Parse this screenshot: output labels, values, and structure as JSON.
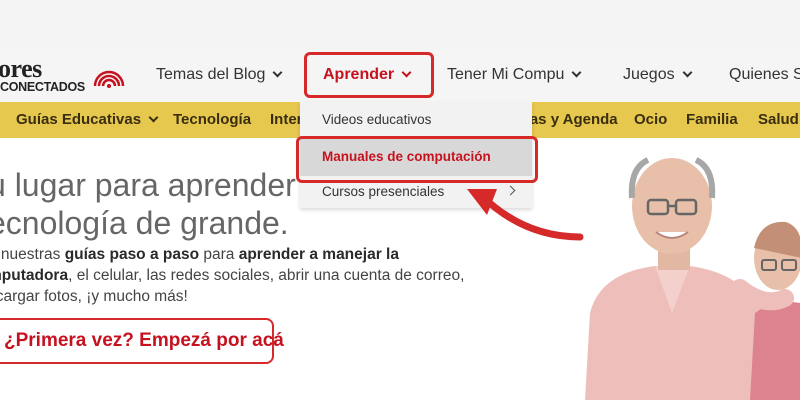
{
  "logo": {
    "top_text": "ores",
    "bottom_text": "CONECTADOS"
  },
  "nav": {
    "items": [
      {
        "label": "Temas del Blog"
      },
      {
        "label": "Aprender"
      },
      {
        "label": "Tener Mi Compu"
      },
      {
        "label": "Juegos"
      },
      {
        "label": "Quienes S"
      }
    ],
    "active_index": 1
  },
  "categories": {
    "items": [
      {
        "label": "Guías Educativas"
      },
      {
        "label": "Tecnología"
      },
      {
        "label": "Intern"
      },
      {
        "label": "ras y Agenda"
      },
      {
        "label": "Ocio"
      },
      {
        "label": "Familia"
      },
      {
        "label": "Salud"
      }
    ]
  },
  "dropdown": {
    "items": [
      {
        "label": "Videos educativos"
      },
      {
        "label": "Manuales de computación"
      },
      {
        "label": "Cursos presenciales"
      }
    ],
    "active_index": 1
  },
  "hero": {
    "title_line1": "u lugar para aprender",
    "title_line2": "ecnología de grande.",
    "body_p1": "á nuestras ",
    "body_b1": "guías paso a paso",
    "body_p2": " para ",
    "body_b2": "aprender a manejar la",
    "body_b3": "mputadora",
    "body_p3": ", el celular, las redes sociales, abrir una cuenta de correo,",
    "body_p4": "scargar fotos, ¡y mucho más!",
    "cta_label": "¿Primera vez? Empezá por acá"
  },
  "colors": {
    "accent_red": "#c6121f",
    "highlight_red": "#d62a2a",
    "category_yellow": "#e7c84e",
    "header_bg": "#f5f5f5"
  },
  "icons": {
    "logo_signal": "wifi-signal-icon",
    "nav_chevron": "chevron-down-icon",
    "submenu_chevron": "chevron-right-icon",
    "annotation": "curved-arrow-icon"
  }
}
